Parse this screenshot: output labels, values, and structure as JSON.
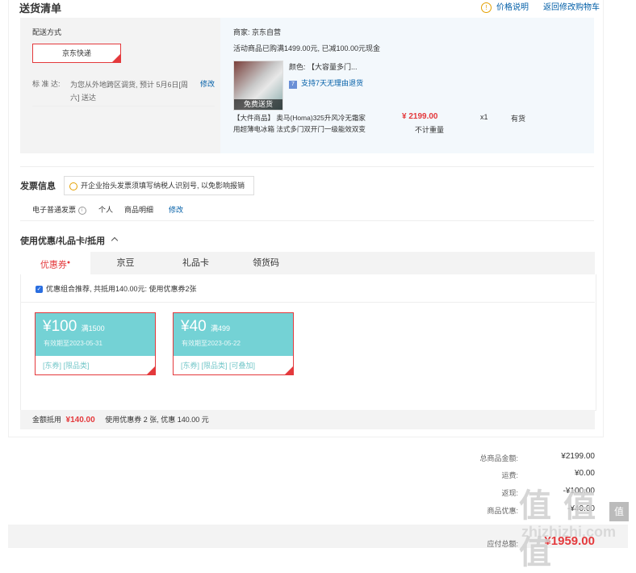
{
  "header": {
    "title": "送货清单",
    "price_info_link": "价格说明",
    "back_to_cart_link": "返回修改购物车"
  },
  "shipping": {
    "method_label": "配送方式",
    "method_value": "京东快递",
    "standard_label": "标 准 达:",
    "standard_text_line1": "为您从外地跨区调货, 预计 5月6日[周",
    "standard_text_line2": "六] 送达",
    "modify_link": "修改"
  },
  "store": {
    "seller": "商家: 京东自营",
    "promo": "活动商品已购满1499.00元, 已减100.00元现金",
    "product": {
      "thumb_badge": "免费送货",
      "color": "颜色: 【大容量多门...",
      "return_policy": "支持7天无理由退货",
      "name_line1": "【大件商品】 奥马(Homa)325升风冷无霜家",
      "name_line2": "用超薄电冰箱 法式多门双开门一级能效双变",
      "price": "¥ 2199.00",
      "weight_note": "不计重量",
      "qty": "x1",
      "stock": "有货"
    }
  },
  "invoice": {
    "title": "发票信息",
    "tip": "开企业抬头发票须填写纳税人识别号, 以免影响报销",
    "type": "电子普通发票",
    "info_icon": "info-circle-icon",
    "holder": "个人",
    "detail": "商品明细",
    "modify_link": "修改"
  },
  "discount": {
    "title": "使用优惠/礼品卡/抵用",
    "tabs": [
      {
        "label": "优惠券"
      },
      {
        "label": "京豆"
      },
      {
        "label": "礼品卡"
      },
      {
        "label": "领货码"
      }
    ],
    "combo_text": "优惠组合推荐, 共抵用140.00元: 使用优惠券2张",
    "coupons": [
      {
        "currency": "¥",
        "amount": "100",
        "condition": "满1500",
        "expiry": "有效期至2023-05-31",
        "tags": "[东券] [限品类]"
      },
      {
        "currency": "¥",
        "amount": "40",
        "condition": "满499",
        "expiry": "有效期至2023-05-22",
        "tags": "[东券] [限品类] [可叠加]"
      }
    ],
    "summary_label": "金额抵用",
    "summary_amount": "¥140.00",
    "summary_desc": "使用优惠券 2 张, 优惠 140.00 元"
  },
  "totals": {
    "goods_label": "总商品金额:",
    "goods_value": "¥2199.00",
    "freight_label": "运费:",
    "freight_value": "¥0.00",
    "cashback_label": "返现:",
    "cashback_value": "-¥100.00",
    "discount_label": "商品优惠:",
    "discount_value": "-¥40.00",
    "payable_label": "应付总额:",
    "payable_value": "¥1959.00"
  },
  "watermark": {
    "logo": "值 值 值",
    "site": "zhizhizhi.com",
    "badge": "值"
  },
  "colors": {
    "accent_red": "#e4393c",
    "link_blue": "#005ea7",
    "coupon_teal": "#74d2d5",
    "panel_blue": "#f3f8fc"
  }
}
